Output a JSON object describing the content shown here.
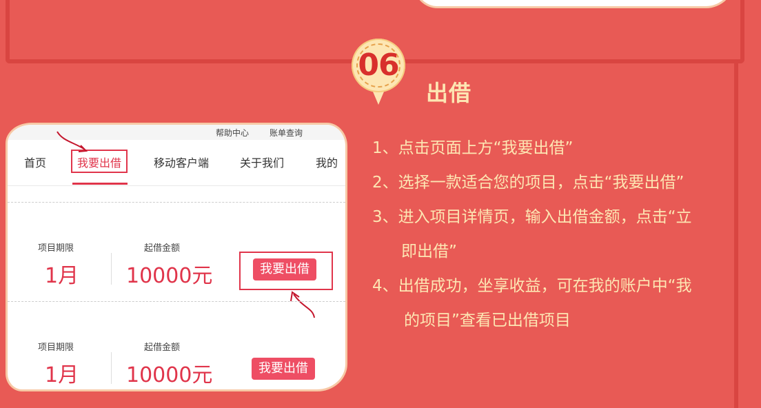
{
  "step": {
    "number": "06",
    "title": "出借",
    "instructions": [
      {
        "line": "1、点击页面上方“我要出借”",
        "cont": ""
      },
      {
        "line": "2、选择一款适合您的项目，点击“我要出借”",
        "cont": ""
      },
      {
        "line": "3、进入项目详情页，输入出借金额，点击“立",
        "cont": "即出借”"
      },
      {
        "line": "4、出借成功，坐享收益，可在我的账户中“我",
        "cont": "的项目”查看已出借项目"
      }
    ]
  },
  "screenshot": {
    "topbar": {
      "help": "帮助中心",
      "bill": "账单查询"
    },
    "nav": {
      "home": "首页",
      "invest": "我要出借",
      "mobile": "移动客户端",
      "about": "关于我们",
      "mine": "我的"
    },
    "projects": [
      {
        "term_label": "项目期限",
        "term_value": "1月",
        "amount_label": "起借金额",
        "amount_value": "10000元",
        "button": "我要出借"
      },
      {
        "term_label": "项目期限",
        "term_value": "1月",
        "amount_label": "起借金额",
        "amount_value": "10000元",
        "button": "我要出借"
      }
    ]
  },
  "colors": {
    "background": "#e85a55",
    "accent": "#e0344a",
    "cream": "#fde6b3"
  }
}
